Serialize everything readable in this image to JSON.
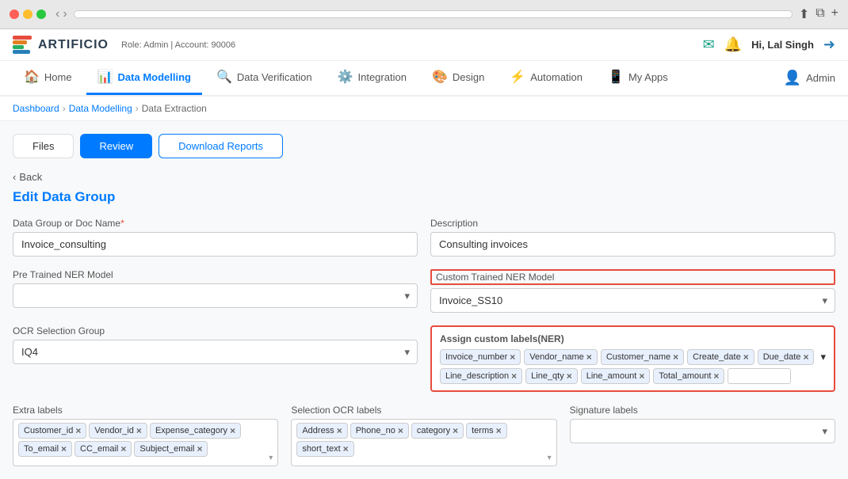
{
  "browser": {
    "url": ""
  },
  "topbar": {
    "logo_text": "ARTIFICIO",
    "role_info": "Role: Admin | Account: 90006",
    "greeting": "Hi, Lal Singh"
  },
  "nav": {
    "items": [
      {
        "id": "home",
        "label": "Home",
        "icon": "🏠",
        "active": false
      },
      {
        "id": "data-modelling",
        "label": "Data Modelling",
        "icon": "📊",
        "active": true
      },
      {
        "id": "data-verification",
        "label": "Data Verification",
        "icon": "🔍",
        "active": false
      },
      {
        "id": "integration",
        "label": "Integration",
        "icon": "⚙️",
        "active": false
      },
      {
        "id": "design",
        "label": "Design",
        "icon": "🎨",
        "active": false
      },
      {
        "id": "automation",
        "label": "Automation",
        "icon": "⚡",
        "active": false
      },
      {
        "id": "my-apps",
        "label": "My Apps",
        "icon": "📱",
        "active": false
      }
    ],
    "right_label": "Admin"
  },
  "breadcrumb": {
    "items": [
      "Dashboard",
      "Data Modelling",
      "Data Extraction"
    ]
  },
  "tabs": {
    "items": [
      {
        "label": "Files",
        "state": "default"
      },
      {
        "label": "Review",
        "state": "active"
      },
      {
        "label": "Download Reports",
        "state": "outline"
      }
    ]
  },
  "back_label": "< Back",
  "page_title": "Edit Data Group",
  "form": {
    "doc_name_label": "Data Group or Doc Name",
    "doc_name_value": "Invoice_consulting",
    "description_label": "Description",
    "description_value": "Consulting invoices",
    "pre_trained_label": "Pre Trained NER Model",
    "pre_trained_value": "",
    "custom_trained_label": "Custom Trained NER Model",
    "custom_trained_value": "Invoice_SS10",
    "ocr_group_label": "OCR Selection Group",
    "ocr_group_value": "IQ4",
    "assign_labels_title": "Assign custom labels(NER)",
    "ner_tags": [
      "Invoice_number",
      "Vendor_name",
      "Customer_name",
      "Create_date",
      "Due_date",
      "Line_description",
      "Line_qty",
      "Line_amount",
      "Total_amount"
    ],
    "extra_labels_label": "Extra labels",
    "extra_tags": [
      "Customer_id",
      "Vendor_id",
      "Expense_category"
    ],
    "extra_tags_row2": [
      "To_email",
      "CC_email",
      "Subject_email"
    ],
    "selection_ocr_label": "Selection OCR labels",
    "selection_tags": [
      "Address",
      "Phone_no",
      "category",
      "terms"
    ],
    "selection_tags_row2": [
      "short_text"
    ],
    "signature_labels_label": "Signature labels",
    "signature_tags": []
  }
}
